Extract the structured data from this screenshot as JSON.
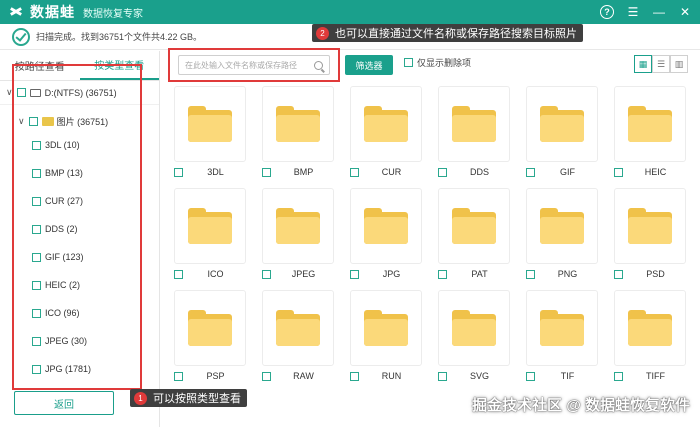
{
  "app": {
    "name": "数据蛙",
    "subtitle": "数据恢复专家"
  },
  "status": {
    "text": "扫描完成。找到36751个文件共4.22 GB。"
  },
  "callouts": [
    {
      "num": "2",
      "text": "也可以直接通过文件名称或保存路径搜索目标照片"
    },
    {
      "num": "1",
      "text": "可以按照类型查看"
    }
  ],
  "tabs": [
    {
      "label": "按路径查看"
    },
    {
      "label": "按类型查看"
    }
  ],
  "tree": {
    "drive": "D:(NTFS) (36751)",
    "category": "图片 (36751)",
    "items": [
      {
        "label": "3DL (10)"
      },
      {
        "label": "BMP (13)"
      },
      {
        "label": "CUR (27)"
      },
      {
        "label": "DDS (2)"
      },
      {
        "label": "GIF (123)"
      },
      {
        "label": "HEIC (2)"
      },
      {
        "label": "ICO (96)"
      },
      {
        "label": "JPEG (30)"
      },
      {
        "label": "JPG (1781)"
      }
    ]
  },
  "back_label": "返回",
  "search": {
    "placeholder": "在此处输入文件名称或保存路径"
  },
  "filter_label": "筛选器",
  "only_deleted_label": "仅显示删除项",
  "files": [
    {
      "name": "3DL"
    },
    {
      "name": "BMP"
    },
    {
      "name": "CUR"
    },
    {
      "name": "DDS"
    },
    {
      "name": "GIF"
    },
    {
      "name": "HEIC"
    },
    {
      "name": "ICO"
    },
    {
      "name": "JPEG"
    },
    {
      "name": "JPG"
    },
    {
      "name": "PAT"
    },
    {
      "name": "PNG"
    },
    {
      "name": "PSD"
    },
    {
      "name": "PSP"
    },
    {
      "name": "RAW"
    },
    {
      "name": "RUN"
    },
    {
      "name": "SVG"
    },
    {
      "name": "TIF"
    },
    {
      "name": "TIFF"
    }
  ],
  "watermark": "掘金技术社区 @ 数据蛙恢复软件",
  "colors": {
    "accent": "#1aa08c",
    "highlight": "#e03a3a",
    "folder": "#f0c24a"
  }
}
